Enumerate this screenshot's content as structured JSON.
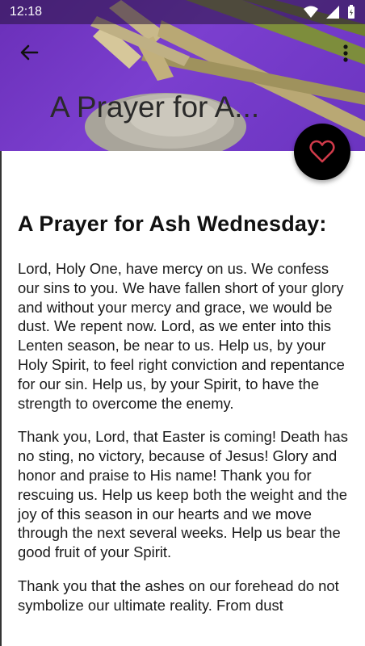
{
  "status_bar": {
    "time": "12:18"
  },
  "header": {
    "title": "A Prayer for A..."
  },
  "article": {
    "heading": "A Prayer for Ash Wednesday:",
    "paragraphs": [
      "Lord, Holy One, have mercy on us. We confess our sins to you. We have fallen short of your glory and without your mercy and grace, we would be dust. We repent now. Lord, as we enter into this Lenten season, be near to us. Help us, by your Holy Spirit, to feel right conviction and repentance for our sin. Help us, by your Spirit, to have the strength to overcome the enemy.",
      "Thank you, Lord, that Easter is coming! Death has no sting, no victory, because of Jesus! Glory and honor and praise to His name! Thank you for rescuing us. Help us keep both the weight and the joy of this season in our hearts and we move through the next several weeks. Help us bear the good fruit of your Spirit.",
      "Thank you that the ashes on our forehead do not symbolize our ultimate reality. From dust"
    ]
  },
  "colors": {
    "accent": "#d03a4a",
    "header_bg": "#7b3fcf",
    "fab_bg": "#000000"
  },
  "icons": {
    "back": "arrow-left-icon",
    "more": "more-vert-icon",
    "favorite": "heart-outline-icon"
  }
}
